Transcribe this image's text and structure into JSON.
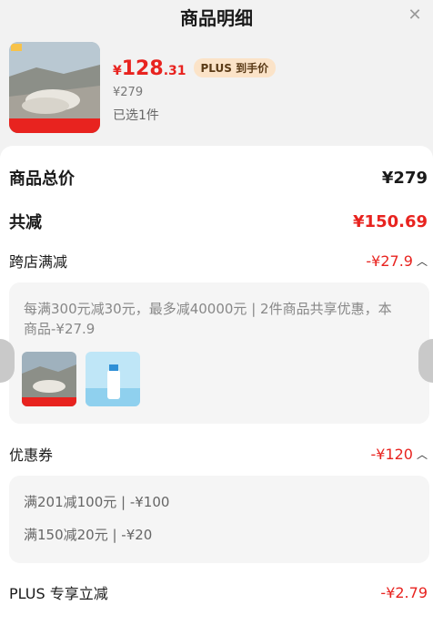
{
  "header": {
    "title": "商品明细"
  },
  "product": {
    "price_currency": "¥",
    "price_int": "128",
    "price_dec": ".31",
    "plus_tag": "PLUS 到手价",
    "original_price": "¥279",
    "selected": "已选1件"
  },
  "summary": {
    "total_label": "商品总价",
    "total_value": "¥279",
    "discount_label": "共减",
    "discount_value": "¥150.69"
  },
  "cross_store": {
    "label": "跨店满减",
    "value": "-¥27.9",
    "description": "每满300元减30元，最多减40000元 | 2件商品共享优惠，本商品-¥27.9"
  },
  "coupons": {
    "label": "优惠券",
    "value": "-¥120",
    "items": [
      "满201减100元 | -¥100",
      "满150减20元 | -¥20"
    ]
  },
  "plus": {
    "label": "PLUS 专享立减",
    "value": "-¥2.79"
  },
  "colors": {
    "accent": "#e8231f",
    "plus_bg": "#fbe3c8"
  },
  "icons": {
    "close": "close-icon",
    "collapse": "chevron-up-icon"
  }
}
